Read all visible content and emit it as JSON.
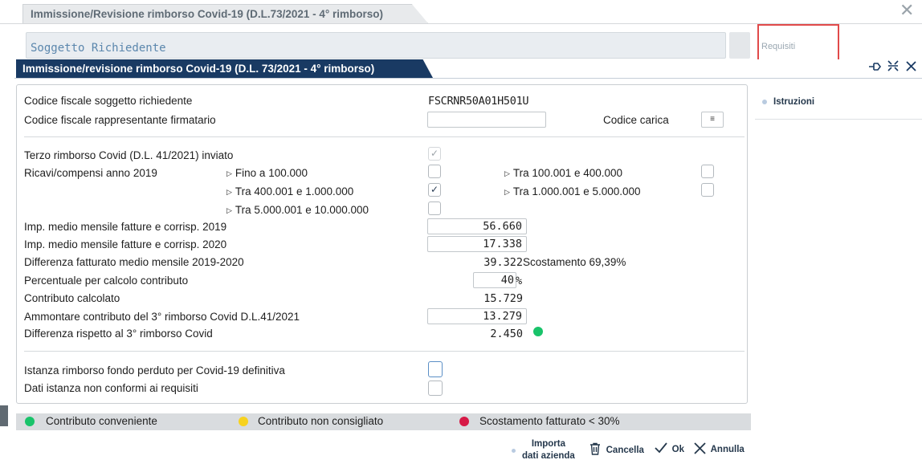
{
  "background_window": {
    "tab_title": "Immissione/Revisione rimborso Covid-19 (D.L.73/2021 - 4° rimborso)",
    "soggetto_label": "Soggetto Richiedente",
    "requisiti_button": "Requisiti"
  },
  "dialog": {
    "title": "Immissione/revisione rimborso Covid-19 (D.L. 73/2021 - 4° rimborso)",
    "header_icons": [
      "pin-icon",
      "collapse-icon",
      "close-icon"
    ]
  },
  "form": {
    "cf_richiedente_label": "Codice fiscale soggetto richiedente",
    "cf_richiedente_value": "FSCRNR50A01H501U",
    "cf_rappresentante_label": "Codice fiscale rappresentante firmatario",
    "cf_rappresentante_value": "",
    "codice_carica_label": "Codice carica",
    "codice_carica_icon": "≡",
    "terzo_rimborso_label": "Terzo rimborso Covid (D.L. 41/2021) inviato",
    "terzo_rimborso_checked": true,
    "ricavi_label": "Ricavi/compensi anno 2019",
    "ricavi_options": [
      {
        "label": "Fino a 100.000",
        "checked": false
      },
      {
        "label": "Tra 100.001 e 400.000",
        "checked": false
      },
      {
        "label": "Tra 400.001 e 1.000.000",
        "checked": true
      },
      {
        "label": "Tra 1.000.001 e 5.000.000",
        "checked": false
      },
      {
        "label": "Tra 5.000.001 e 10.000.000",
        "checked": false
      }
    ],
    "imp_2019_label": "Imp. medio mensile fatture e corrisp. 2019",
    "imp_2019_value": "56.660",
    "imp_2020_label": "Imp. medio mensile fatture e corrisp. 2020",
    "imp_2020_value": "17.338",
    "differenza_label": "Differenza fatturato medio mensile 2019-2020",
    "differenza_value": "39.322",
    "scostamento_text": "Scostamento 69,39%",
    "percentuale_label": "Percentuale per calcolo contributo",
    "percentuale_value": "40",
    "percent_sign": "%",
    "contributo_label": "Contributo calcolato",
    "contributo_value": "15.729",
    "ammontare_label": "Ammontare contributo del 3° rimborso Covid D.L.41/2021",
    "ammontare_value": "13.279",
    "diff_3_label": "Differenza rispetto al 3° rimborso Covid",
    "diff_3_value": "2.450",
    "diff_3_status_color": "#19c36a",
    "istanza_label": "Istanza rimborso fondo perduto per Covid-19 definitiva",
    "istanza_checked": false,
    "non_conformi_label": "Dati istanza non conformi ai requisiti",
    "non_conformi_checked": false
  },
  "sidebar": {
    "items": [
      {
        "label": "Istruzioni"
      }
    ]
  },
  "legend": [
    {
      "label": "Contributo conveniente",
      "color": "#19c36a"
    },
    {
      "label": "Contributo non consigliato",
      "color": "#f7d21f"
    },
    {
      "label": "Scostamento fatturato < 30%",
      "color": "#d61a47"
    }
  ],
  "toolbar": {
    "importa_line1": "Importa",
    "importa_line2": "dati azienda",
    "cancella": "Cancella",
    "ok": "Ok",
    "annulla": "Annulla"
  }
}
